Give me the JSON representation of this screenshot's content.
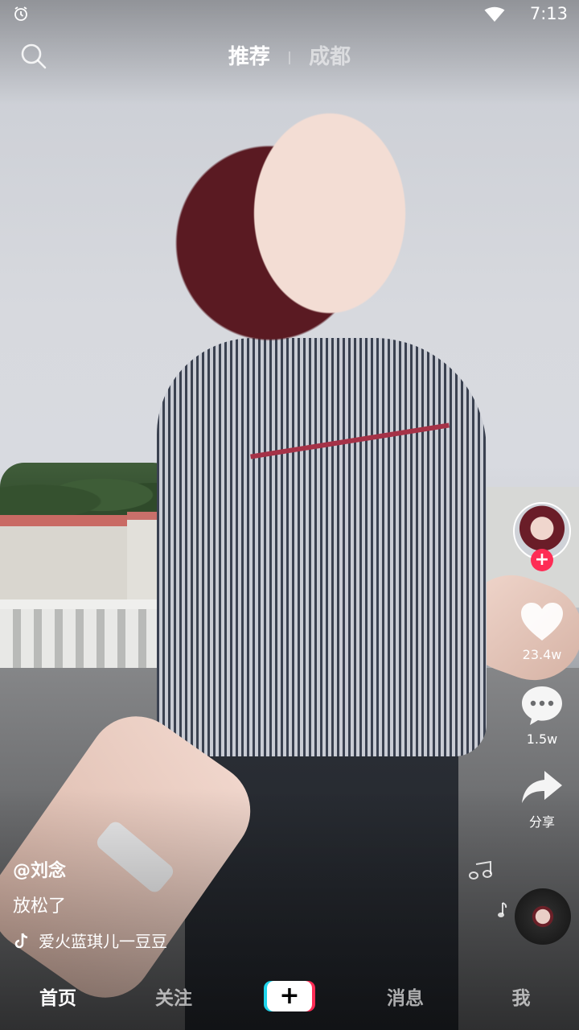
{
  "status_bar": {
    "time": "7:13",
    "alarm_icon": "alarm-icon",
    "wifi_icon": "wifi-icon"
  },
  "top_nav": {
    "search_icon": "search-icon",
    "tabs": [
      {
        "label": "推荐",
        "active": true
      },
      {
        "label": "成都",
        "active": false
      }
    ]
  },
  "actions": {
    "follow_icon": "plus-icon",
    "like_count": "23.4w",
    "comment_count": "1.5w",
    "share_label": "分享"
  },
  "caption": {
    "author": "@刘念",
    "description": "放松了",
    "music": "爱火蓝琪儿一豆豆"
  },
  "bottom_nav": {
    "items": [
      {
        "label": "首页",
        "active": true
      },
      {
        "label": "关注",
        "active": false
      },
      {
        "label": "+",
        "active": false
      },
      {
        "label": "消息",
        "active": false
      },
      {
        "label": "我",
        "active": false
      }
    ]
  },
  "colors": {
    "accent_red": "#fe2c55",
    "accent_cyan": "#20d5ec"
  }
}
